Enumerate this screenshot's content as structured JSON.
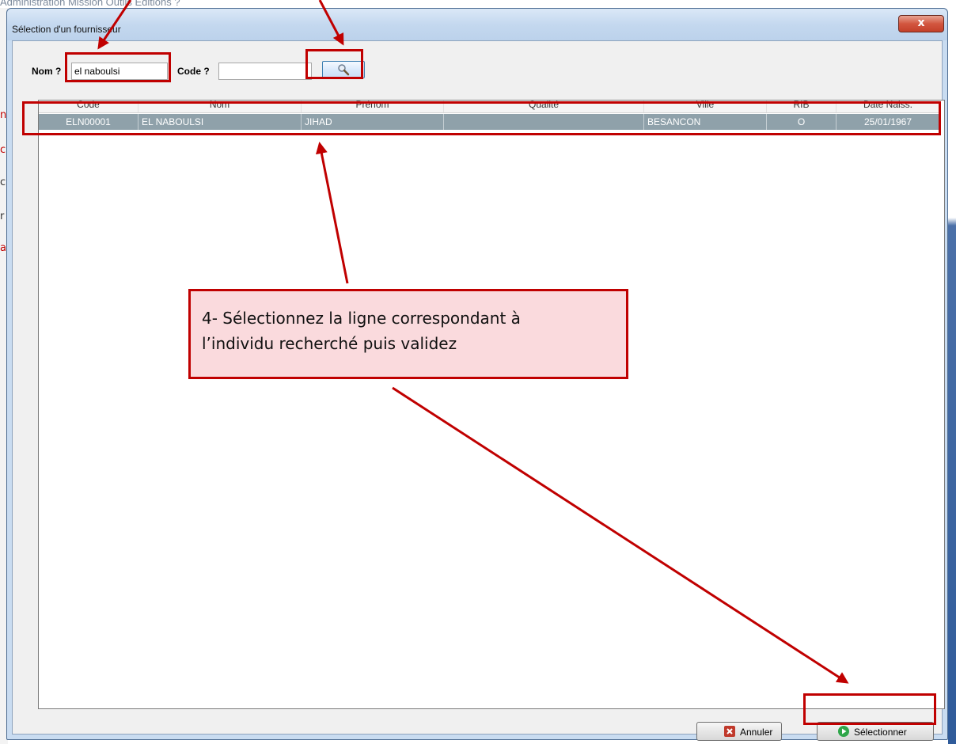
{
  "background": {
    "menubar_text": "Administration  Mission  Outils  Editions  ?",
    "left_glyphs": [
      "n",
      "c",
      "c",
      "r",
      "a"
    ]
  },
  "window": {
    "title": "Sélection d'un fournisseur",
    "close_label": "x"
  },
  "search": {
    "nom_label": "Nom ?",
    "nom_value": "el naboulsi",
    "code_label": "Code ?",
    "code_value": "",
    "search_icon": "magnifier-icon"
  },
  "table": {
    "columns": [
      "Code",
      "Nom",
      "Prénom",
      "Qualité",
      "Ville",
      "RIB",
      "Date Naiss."
    ],
    "rows": [
      [
        "ELN00001",
        "EL NABOULSI",
        "JIHAD",
        "",
        "BESANCON",
        "O",
        "25/01/1967"
      ]
    ]
  },
  "annotation": {
    "line1": "4- Sélectionnez la ligne correspondant à",
    "line2": "l’individu recherché puis validez"
  },
  "buttons": {
    "cancel_label": "Annuler",
    "select_label": "Sélectionner"
  },
  "colors": {
    "highlight": "#c00000",
    "selected_row": "#8fa1aa",
    "callout_fill": "#fadadd"
  }
}
